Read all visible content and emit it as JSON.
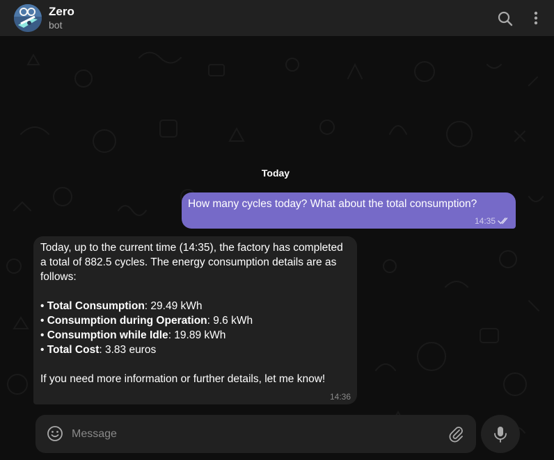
{
  "header": {
    "title": "Zero",
    "subtitle": "bot",
    "icons": [
      "search-icon",
      "more-vertical-icon"
    ]
  },
  "chat": {
    "date_label": "Today",
    "messages": [
      {
        "direction": "outgoing",
        "text": "How many cycles today? What about the total consumption?",
        "time": "14:35",
        "status": "read"
      },
      {
        "direction": "incoming",
        "intro": "Today, up to the current time (14:35), the factory has completed a total of 882.5 cycles. The energy consumption details are as follows:",
        "items": [
          {
            "bullet": "• ",
            "label": "Total Consumption",
            "value": ": 29.49 kWh"
          },
          {
            "bullet": "• ",
            "label": "Consumption during Operation",
            "value": ": 9.6 kWh"
          },
          {
            "bullet": "• ",
            "label": "Consumption while Idle",
            "value": ": 19.89 kWh"
          },
          {
            "bullet": "• ",
            "label": "Total Cost",
            "value": ": 3.83 euros"
          }
        ],
        "outro": "If you need more information or further details, let me know!",
        "time": "14:36"
      }
    ]
  },
  "composer": {
    "placeholder": "Message",
    "icons": [
      "emoji-icon",
      "attach-icon",
      "mic-icon"
    ]
  },
  "colors": {
    "header_bg": "#212121",
    "chat_bg": "#0e0e0e",
    "outgoing_bubble": "#766ac8",
    "incoming_bubble": "#212121",
    "text": "#ffffff",
    "muted": "#aaaaaa"
  }
}
